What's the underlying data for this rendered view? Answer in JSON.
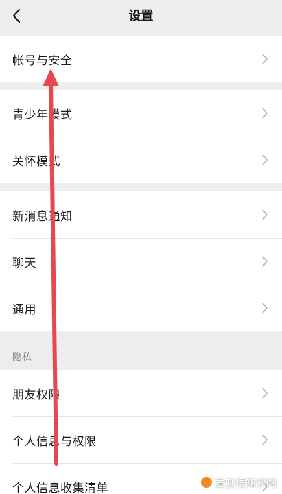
{
  "header": {
    "title": "设置"
  },
  "groups": [
    {
      "items": [
        {
          "label": "帐号与安全"
        }
      ]
    },
    {
      "items": [
        {
          "label": "青少年模式"
        },
        {
          "label": "关怀模式"
        }
      ]
    },
    {
      "items": [
        {
          "label": "新消息通知"
        },
        {
          "label": "聊天"
        },
        {
          "label": "通用"
        }
      ]
    }
  ],
  "privacy_section": {
    "header": "隐私",
    "items": [
      {
        "label": "朋友权限"
      },
      {
        "label": "个人信息与权限"
      },
      {
        "label": "个人信息收集清单"
      }
    ]
  },
  "watermark": {
    "text": "爱刨根知识网"
  },
  "colors": {
    "background": "#ededed",
    "row_background": "#ffffff",
    "text": "#191919",
    "secondary_text": "#7f7f7f",
    "chevron": "#b2b2b2",
    "annotation_arrow": "#e8474f"
  },
  "icons": {
    "back": "chevron-left-icon",
    "row_arrow": "chevron-right-icon"
  }
}
